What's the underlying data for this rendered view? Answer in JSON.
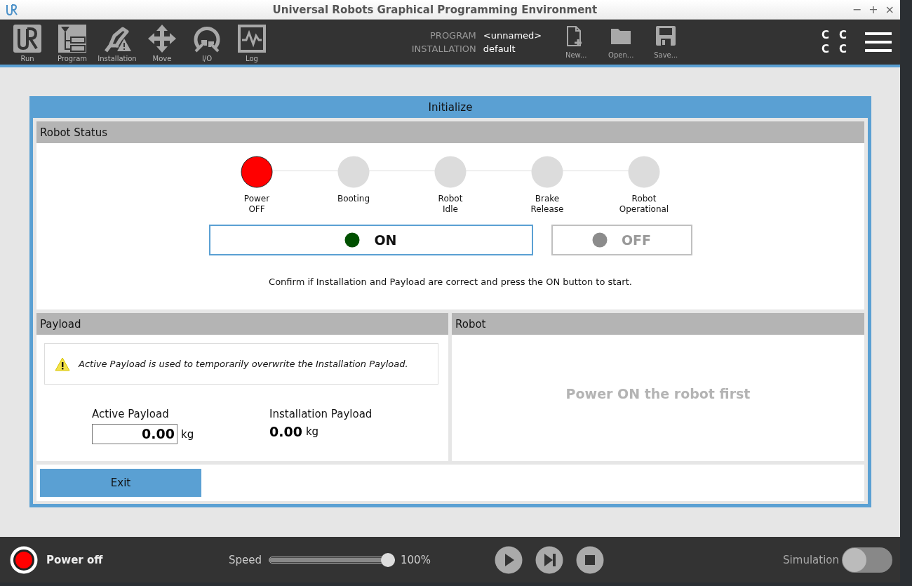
{
  "window": {
    "title": "Universal Robots Graphical Programming Environment",
    "controls": [
      "−",
      "+",
      "×"
    ]
  },
  "nav": [
    {
      "label": "Run",
      "selected": false
    },
    {
      "label": "Program",
      "selected": false
    },
    {
      "label": "Installation",
      "selected": false
    },
    {
      "label": "Move",
      "selected": false
    },
    {
      "label": "I/O",
      "selected": false
    },
    {
      "label": "Log",
      "selected": false
    }
  ],
  "program_info": [
    {
      "label": "PROGRAM",
      "value": "<unnamed>"
    },
    {
      "label": "INSTALLATION",
      "value": "default"
    }
  ],
  "file_buttons": [
    {
      "label": "New..."
    },
    {
      "label": "Open..."
    },
    {
      "label": "Save..."
    }
  ],
  "status_letters": [
    "C",
    "C",
    "C",
    "C"
  ],
  "dialog": {
    "title": "Initialize",
    "robot_status": {
      "title": "Robot Status",
      "steps": [
        {
          "label": "Power\nOFF",
          "active": true
        },
        {
          "label": "Booting",
          "active": false
        },
        {
          "label": "Robot\nIdle",
          "active": false
        },
        {
          "label": "Brake\nRelease",
          "active": false
        },
        {
          "label": "Robot\nOperational",
          "active": false
        }
      ],
      "buttons": [
        {
          "label": "ON",
          "disabled": false,
          "color": "#005000"
        },
        {
          "label": "OFF",
          "disabled": true,
          "color": "#8c8c8c"
        }
      ],
      "message": "Confirm if Installation and Payload are correct and press the ON button to start."
    },
    "payload": {
      "title": "Payload",
      "warning": "Active Payload is used to temporarily overwrite the Installation Payload.",
      "active_label": "Active Payload",
      "active_value": "0.00",
      "active_unit": "kg",
      "installation_label": "Installation Payload",
      "installation_value": "0.00",
      "installation_unit": "kg"
    },
    "robot": {
      "title": "Robot",
      "message": "Power ON the robot first"
    },
    "exit_button": "Exit"
  },
  "footer": {
    "power_label": "Power off",
    "powered": false,
    "speed_label": "Speed",
    "speed": {
      "level": 1.0
    },
    "speed_reading": "100%",
    "simulation_label": "Simulation",
    "simulation": {
      "on": false
    }
  }
}
